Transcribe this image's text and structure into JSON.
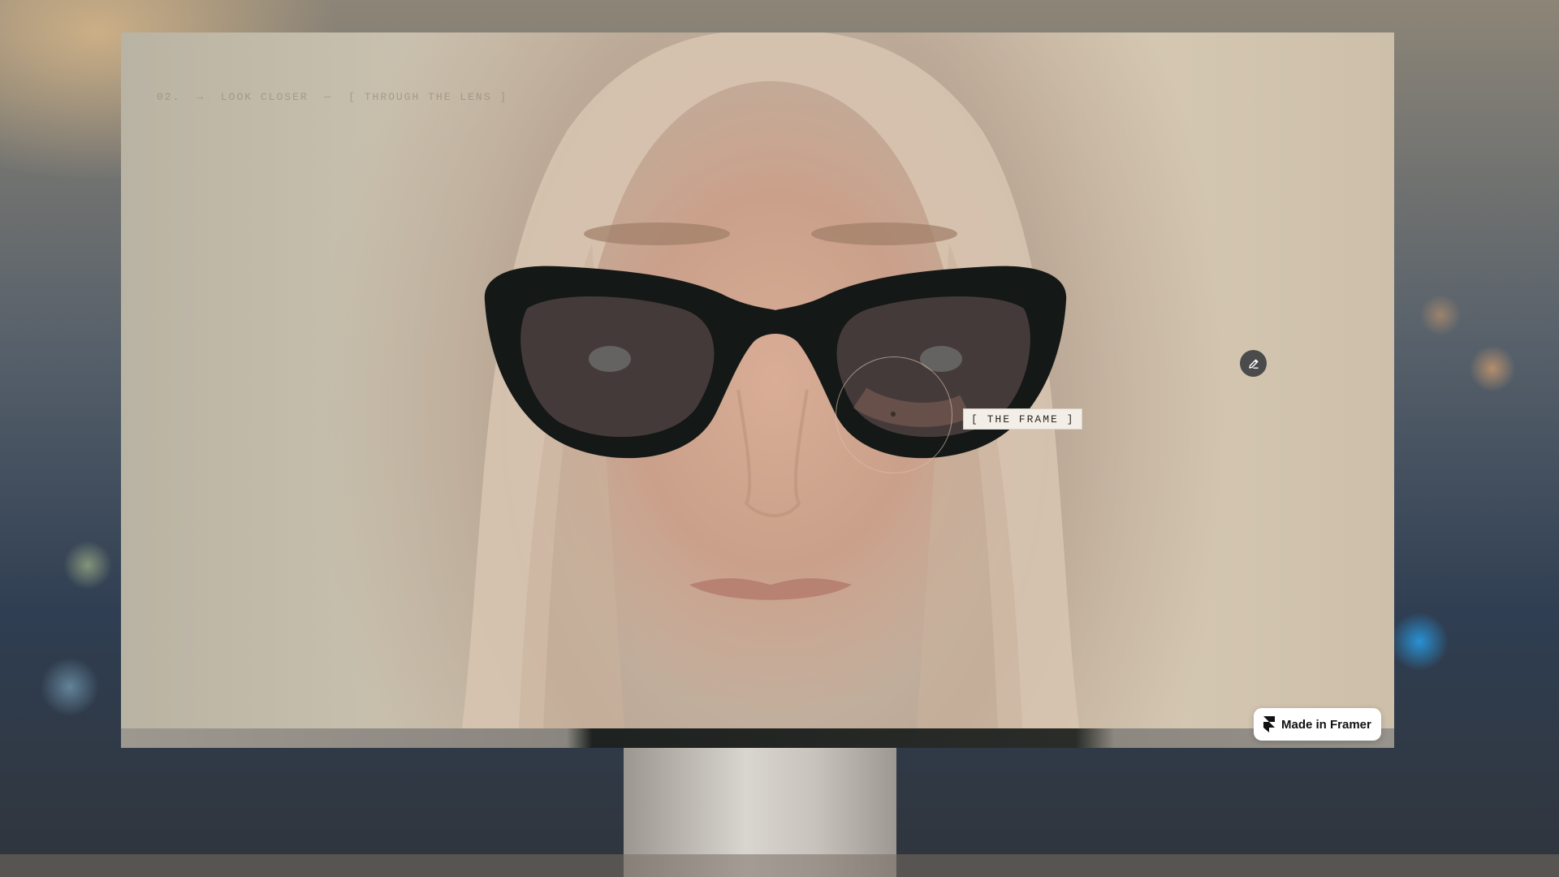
{
  "caption": {
    "index": "02.",
    "arrow": "→",
    "title": "LOOK CLOSER",
    "separator": "—",
    "subtitle": "[ THROUGH THE LENS ]"
  },
  "hotspot": {
    "label": "[ THE FRAME ]"
  },
  "toolbar": {
    "edit_icon": "pencil-icon"
  },
  "badge": {
    "label": "Made in Framer",
    "icon": "framer-logo-icon"
  },
  "colors": {
    "badge_bg": "#ffffff",
    "label_bg": "#f3efe8",
    "edit_button_bg": "#4b4b4b"
  }
}
